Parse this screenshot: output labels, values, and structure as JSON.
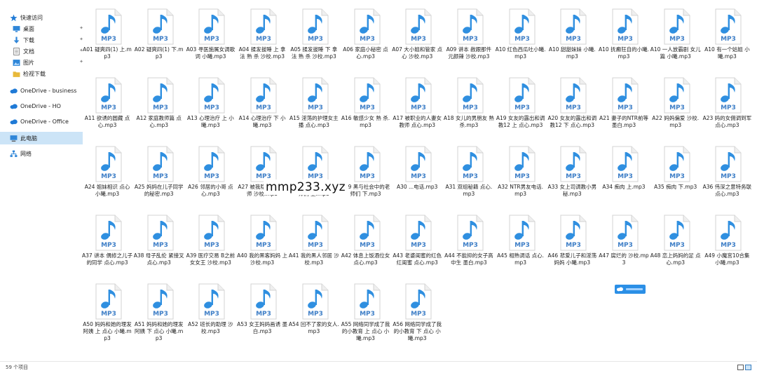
{
  "nav": {
    "items": [
      {
        "label": "快速访问",
        "icon": "star-icon",
        "color": "#1f7ad6",
        "pinned": false,
        "indent": 0
      },
      {
        "label": "桌面",
        "icon": "desktop-icon",
        "color": "#2f86d8",
        "pinned": true,
        "indent": 1
      },
      {
        "label": "下载",
        "icon": "download-icon",
        "color": "#2f86d8",
        "pinned": true,
        "indent": 1
      },
      {
        "label": "文档",
        "icon": "document-icon",
        "color": "#7a7a7a",
        "pinned": true,
        "indent": 1
      },
      {
        "label": "图片",
        "icon": "pictures-icon",
        "color": "#2f86d8",
        "pinned": true,
        "indent": 1
      },
      {
        "label": "检视下载",
        "icon": "folder-icon",
        "color": "#e8b93a",
        "pinned": false,
        "indent": 1
      },
      {
        "label": "OneDrive - business",
        "icon": "cloud-icon",
        "color": "#1f7ad6",
        "pinned": false,
        "indent": 0
      },
      {
        "label": "OneDrive - HO",
        "icon": "cloud-icon",
        "color": "#1f7ad6",
        "pinned": false,
        "indent": 0
      },
      {
        "label": "OneDrive - Office",
        "icon": "cloud-icon",
        "color": "#1f7ad6",
        "pinned": false,
        "indent": 0
      },
      {
        "label": "此电脑",
        "icon": "computer-icon",
        "color": "#2f86d8",
        "pinned": false,
        "indent": 0,
        "selected": true
      },
      {
        "label": "网络",
        "icon": "network-icon",
        "color": "#2f86d8",
        "pinned": false,
        "indent": 0
      }
    ]
  },
  "files": [
    {
      "name": "A01 疑爽四(1) 上.mp3"
    },
    {
      "name": "A02 疑爽四(1) 下.mp3"
    },
    {
      "name": "A03 寻医施属女调歌词 小曦.mp3"
    },
    {
      "name": "A04 揉发拔睡 上 拿法 熟 杀 沙校.mp3"
    },
    {
      "name": "A05 揉发拔睡 下 拿法 熟 杀 沙校.mp3"
    },
    {
      "name": "A06 家庭小秘密 点心.mp3"
    },
    {
      "name": "A07 大小姐和管家 点心 沙校.mp3"
    },
    {
      "name": "A09 讲本 赦跟那件 元颜辣 沙校.mp3"
    },
    {
      "name": "A10 红色西瓜吐小曦.mp3"
    },
    {
      "name": "A10 甜甜妹妹 小曦.mp3"
    },
    {
      "name": "A10 抚癫狂自的小曦.mp3"
    },
    {
      "name": "A10 一人放霸剧 女儿篇 小曦.mp3"
    },
    {
      "name": "A10 有一个姑姐 小曦.mp3"
    },
    {
      "name": "A11 欲诱的圆藏 点心.mp3"
    },
    {
      "name": "A12 家庭教师篇 点心.mp3"
    },
    {
      "name": "A13 心理治疗 上 小曦.mp3"
    },
    {
      "name": "A14 心理治疗 下 小曦.mp3"
    },
    {
      "name": "A15 淫荡的护理女主播 点心.mp3"
    },
    {
      "name": "A16 敏感少女 熟 杀.mp3"
    },
    {
      "name": "A17 被职业的人妻女教师 点心.mp3"
    },
    {
      "name": "A18 女儿的男朋友 熟 杀.mp3"
    },
    {
      "name": "A19 女友的露出和调教12 上 点心.mp3"
    },
    {
      "name": "A20 女友的露出和调教12 下 点心.mp3"
    },
    {
      "name": "A21 妻子的NTR前等 墨白.mp3"
    },
    {
      "name": "A22 妈妈偏爱 沙校.mp3"
    },
    {
      "name": "A23 妈的女佣调到军 点心.mp3"
    },
    {
      "name": "A24 姐妹相识 点心 小曦.mp3"
    },
    {
      "name": "A25 妈妈在儿子同学的秘密.mp3"
    },
    {
      "name": "A26 邻居的小哥 点心.mp3"
    },
    {
      "name": "A27 被我隐心的女老师 沙校.mp3"
    },
    {
      "name": "A28 黑与社会中的老师们 上.mp3"
    },
    {
      "name": "A29 黑与社会中的老师们 下.mp3"
    },
    {
      "name": "A30 ...电话.mp3"
    },
    {
      "name": "A31 双组秘籍 点心.mp3"
    },
    {
      "name": "A32 NTR男友电话.mp3"
    },
    {
      "name": "A33 女上司调教小男秘.mp3"
    },
    {
      "name": "A34 痴肉 上.mp3"
    },
    {
      "name": "A35 痴肉 下.mp3"
    },
    {
      "name": "A36 伟深之意特务联点心.mp3"
    },
    {
      "name": "A37 讲本 偶修之儿子的同学 点心.mp3"
    },
    {
      "name": "A38 母子乱伦 紧接叉 点心.mp3"
    },
    {
      "name": "A39 医疗交易 B之前女女王 沙校.mp3"
    },
    {
      "name": "A40 我的黑客妈妈 上 沙校.mp3"
    },
    {
      "name": "A41 我的黑人邻居 沙校.mp3"
    },
    {
      "name": "A42 体息上饭酒位女 点心.mp3"
    },
    {
      "name": "A43 老婆闺蜜的红色红闺蜜 点心.mp3"
    },
    {
      "name": "A44 不能抑的女子高中生 墨白.mp3"
    },
    {
      "name": "A45 相熟调话 点心.mp3"
    },
    {
      "name": "A46 悲爱儿子和淫荡妈妈 小曦.mp3"
    },
    {
      "name": "A47 腐烂的 沙校.mp3"
    },
    {
      "name": "A48 恋上妈妈的足 点心.mp3"
    },
    {
      "name": "A49 小魔宫10合集 小曦.mp3"
    },
    {
      "name": "A50 妈妈和她的理发阿姨 上 点心 小曦.mp3"
    },
    {
      "name": "A51 妈妈和她的理发阿姨 下 点心 小曦.mp3"
    },
    {
      "name": "A52 班长的助理 沙校.mp3"
    },
    {
      "name": "A53 女王妈妈画诱 墨白.mp3"
    },
    {
      "name": "A54 回不了家的女人.mp3"
    },
    {
      "name": "A55 网络同学成了我的小教育 上 点心 小曦.mp3"
    },
    {
      "name": "A56 网络同学成了我的小教育 下 点心 小曦.mp3"
    }
  ],
  "icon_badge": "MP3",
  "colors": {
    "note": "#2f8fe0",
    "badge_text": "#3f7fc7",
    "selected_bg": "#cce4f7"
  },
  "watermark": "mmp233.xyz",
  "status": {
    "count_text": "59 个项目"
  }
}
